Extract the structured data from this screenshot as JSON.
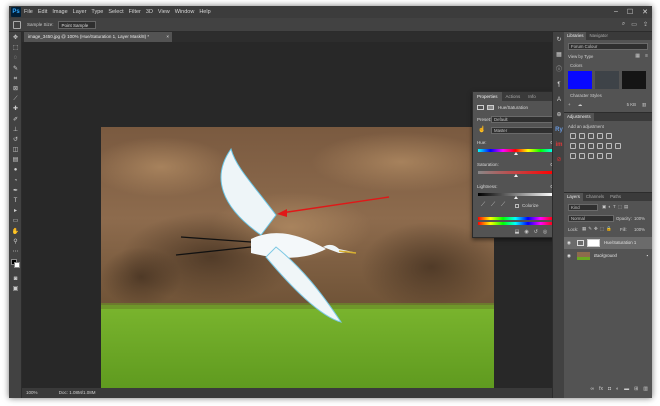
{
  "app": {
    "logo": "Ps"
  },
  "menu": [
    "File",
    "Edit",
    "Image",
    "Layer",
    "Type",
    "Select",
    "Filter",
    "3D",
    "View",
    "Window",
    "Help"
  ],
  "window_controls": {
    "minimize": "–",
    "maximize": "☐",
    "close": "✕"
  },
  "options_bar": {
    "sample_size_label": "Sample Size:",
    "sample_size_value": "Point Sample"
  },
  "document": {
    "tab_title": "image_3450.jpg @ 100% (Hue/Saturation 1, Layer Mask/8) *",
    "tab_close": "×"
  },
  "status": {
    "zoom": "100%",
    "doc_info": "Doc: 1.08M/1.08M"
  },
  "properties": {
    "tabs": [
      "Properties",
      "Actions",
      "Info"
    ],
    "header": "Hue/Saturation",
    "preset_label": "Preset:",
    "preset_value": "Default",
    "channel_value": "Master",
    "hue_label": "Hue:",
    "hue_value": "0",
    "saturation_label": "Saturation:",
    "saturation_value": "0",
    "lightness_label": "Lightness:",
    "lightness_value": "0",
    "colorize_label": "Colorize"
  },
  "libraries": {
    "tabs": [
      "Libraries",
      "Navigator"
    ],
    "library_value": "Forum Colour",
    "view_by": "View by Type",
    "colors_label": "Colors",
    "color_swatches": [
      "#0808ff",
      "#3e4348",
      "#151515"
    ],
    "char_styles_label": "Character Styles",
    "size_readout": "5 KB"
  },
  "adjustments": {
    "title": "Adjustments",
    "add_label": "Add an adjustment"
  },
  "layers": {
    "tabs": [
      "Layers",
      "Channels",
      "Paths"
    ],
    "kind_value": "Kind",
    "blend_value": "Normal",
    "opacity_label": "Opacity:",
    "opacity_value": "100%",
    "lock_label": "Lock:",
    "fill_label": "Fill:",
    "fill_value": "100%",
    "items": [
      {
        "name": "Hue/Saturation 1",
        "selected": true
      },
      {
        "name": "Background",
        "selected": false
      }
    ]
  },
  "colors": {
    "accent": "#31a8ff",
    "arrow": "#e01818",
    "photo_sky": "#8a6a4a",
    "grass": "#6aa822"
  }
}
